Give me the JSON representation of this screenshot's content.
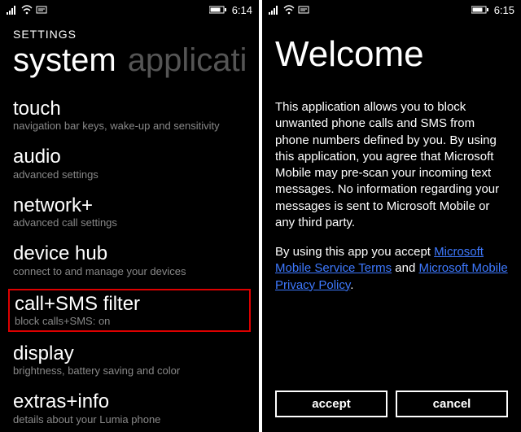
{
  "left": {
    "status": {
      "time": "6:14"
    },
    "header": "SETTINGS",
    "pivot": {
      "active": "system",
      "inactive": "applicati"
    },
    "items": [
      {
        "title": "touch",
        "subtitle": "navigation bar keys, wake-up and sensitivity"
      },
      {
        "title": "audio",
        "subtitle": "advanced settings"
      },
      {
        "title": "network+",
        "subtitle": "advanced call settings"
      },
      {
        "title": "device hub",
        "subtitle": "connect to and manage your devices"
      },
      {
        "title": "call+SMS filter",
        "subtitle": "block calls+SMS: on"
      },
      {
        "title": "display",
        "subtitle": "brightness, battery saving and color"
      },
      {
        "title": "extras+info",
        "subtitle": "details about your Lumia phone"
      }
    ]
  },
  "right": {
    "status": {
      "time": "6:15"
    },
    "title": "Welcome",
    "body": "This application allows you to block unwanted phone calls and SMS from phone numbers defined by you. By using this application, you agree that Microsoft Mobile may pre-scan your incoming text messages. No information regarding your messages is sent to Microsoft Mobile or any third party.",
    "terms_prefix": "By using this app you accept ",
    "link1": "Microsoft Mobile Service Terms",
    "terms_mid": " and ",
    "link2": "Microsoft Mobile Privacy Policy",
    "terms_suffix": ".",
    "buttons": {
      "accept": "accept",
      "cancel": "cancel"
    }
  }
}
